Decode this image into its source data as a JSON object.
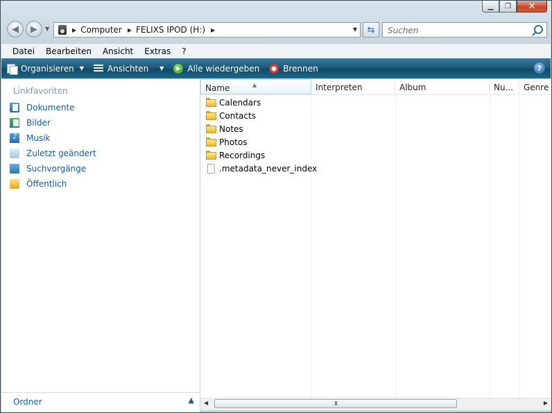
{
  "window": {
    "minimize_icon": "minimize-icon",
    "maximize_icon": "maximize-icon",
    "close_icon": "close-icon"
  },
  "address_bar": {
    "device_icon": "ipod-icon",
    "breadcrumbs": [
      "Computer",
      "FELIXS IPOD (H:)"
    ]
  },
  "search": {
    "placeholder": "Suchen"
  },
  "menu": [
    "Datei",
    "Bearbeiten",
    "Ansicht",
    "Extras",
    "?"
  ],
  "commands": {
    "organize": "Organisieren",
    "views": "Ansichten",
    "play_all": "Alle wiedergeben",
    "burn": "Brennen"
  },
  "nav_pane": {
    "title": "Linkfavoriten",
    "links": [
      {
        "label": "Dokumente",
        "icon": "documents-icon"
      },
      {
        "label": "Bilder",
        "icon": "pictures-icon"
      },
      {
        "label": "Musik",
        "icon": "music-icon"
      },
      {
        "label": "Zuletzt geändert",
        "icon": "recent-icon"
      },
      {
        "label": "Suchvorgänge",
        "icon": "searches-icon"
      },
      {
        "label": "Öffentlich",
        "icon": "public-folder-icon"
      }
    ],
    "footer": "Ordner"
  },
  "columns": [
    "Name",
    "Interpreten",
    "Album",
    "Nu...",
    "Genre"
  ],
  "files": [
    {
      "name": "Calendars",
      "type": "folder"
    },
    {
      "name": "Contacts",
      "type": "folder"
    },
    {
      "name": "Notes",
      "type": "folder"
    },
    {
      "name": "Photos",
      "type": "folder"
    },
    {
      "name": "Recordings",
      "type": "folder"
    },
    {
      "name": ".metadata_never_index",
      "type": "file"
    }
  ],
  "scrollbar": {
    "grip": "III"
  }
}
